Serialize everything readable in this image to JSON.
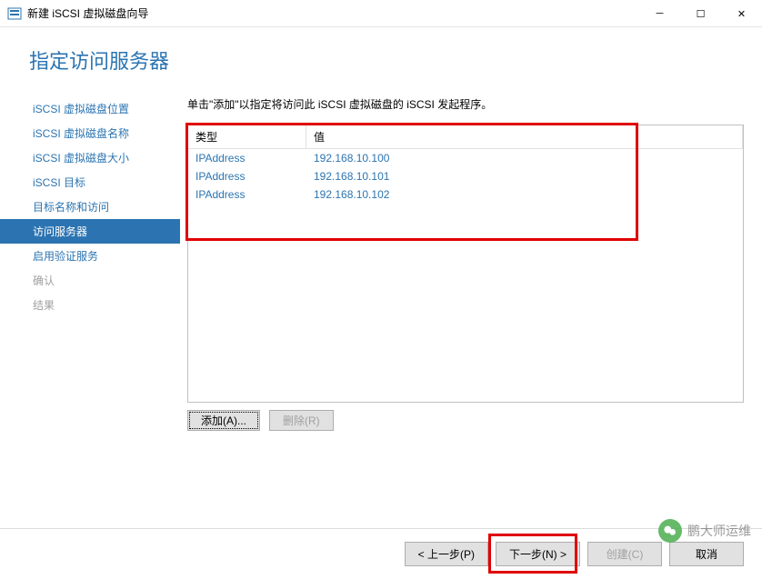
{
  "window": {
    "title": "新建 iSCSI 虚拟磁盘向导"
  },
  "header": {
    "title": "指定访问服务器"
  },
  "sidebar": {
    "items": [
      {
        "label": "iSCSI 虚拟磁盘位置",
        "state": "normal"
      },
      {
        "label": "iSCSI 虚拟磁盘名称",
        "state": "normal"
      },
      {
        "label": "iSCSI 虚拟磁盘大小",
        "state": "normal"
      },
      {
        "label": "iSCSI 目标",
        "state": "normal"
      },
      {
        "label": "目标名称和访问",
        "state": "normal"
      },
      {
        "label": "访问服务器",
        "state": "active"
      },
      {
        "label": "启用验证服务",
        "state": "normal"
      },
      {
        "label": "确认",
        "state": "disabled"
      },
      {
        "label": "结果",
        "state": "disabled"
      }
    ]
  },
  "main": {
    "instruction": "单击\"添加\"以指定将访问此 iSCSI 虚拟磁盘的 iSCSI 发起程序。",
    "table": {
      "columns": {
        "type": "类型",
        "value": "值"
      },
      "rows": [
        {
          "type": "IPAddress",
          "value": "192.168.10.100"
        },
        {
          "type": "IPAddress",
          "value": "192.168.10.101"
        },
        {
          "type": "IPAddress",
          "value": "192.168.10.102"
        }
      ]
    },
    "buttons": {
      "add": "添加(A)...",
      "remove": "删除(R)"
    }
  },
  "footer": {
    "previous": "< 上一步(P)",
    "next": "下一步(N) >",
    "create": "创建(C)",
    "cancel": "取消"
  },
  "watermark": {
    "text": "鹏大师运维"
  }
}
